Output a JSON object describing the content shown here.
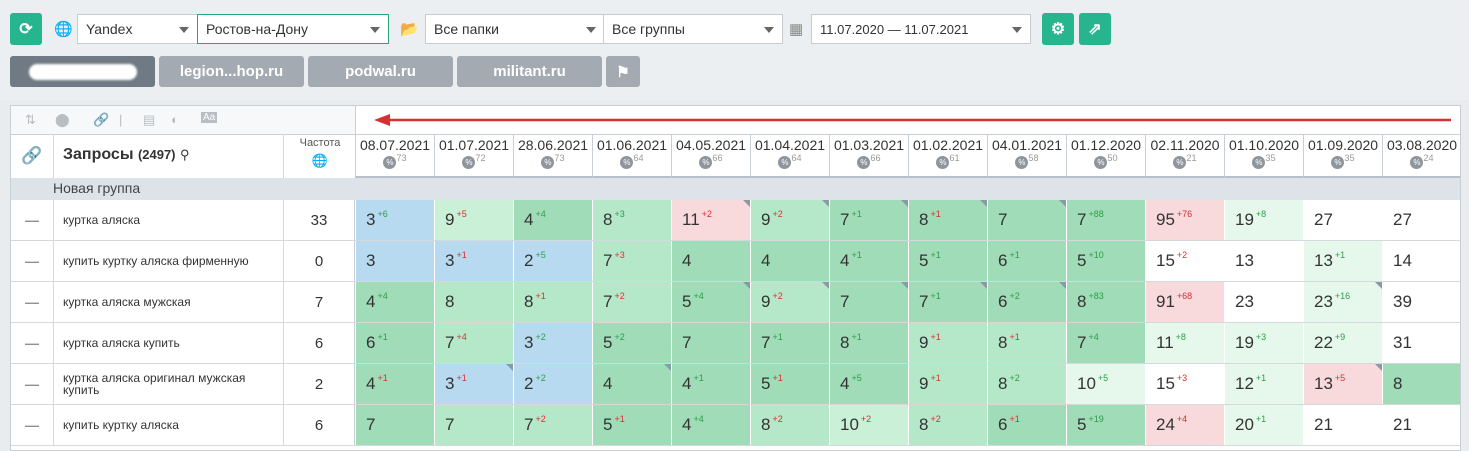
{
  "toolbar": {
    "engine": "Yandex",
    "region": "Ростов-на-Дону",
    "folders": "Все папки",
    "groups": "Все группы",
    "date_range": "11.07.2020 — 11.07.2021"
  },
  "tabs": [
    "legion...hop.ru",
    "podwal.ru",
    "militant.ru"
  ],
  "table": {
    "title": "Запросы",
    "count": "(2497)",
    "freq_label": "Частота",
    "group": "Новая группа",
    "dates": [
      {
        "d": "08.07.2021",
        "p": "73"
      },
      {
        "d": "01.07.2021",
        "p": "72"
      },
      {
        "d": "28.06.2021",
        "p": "73"
      },
      {
        "d": "01.06.2021",
        "p": "64"
      },
      {
        "d": "04.05.2021",
        "p": "66"
      },
      {
        "d": "01.04.2021",
        "p": "64"
      },
      {
        "d": "01.03.2021",
        "p": "66"
      },
      {
        "d": "01.02.2021",
        "p": "61"
      },
      {
        "d": "04.01.2021",
        "p": "58"
      },
      {
        "d": "01.12.2020",
        "p": "50"
      },
      {
        "d": "02.11.2020",
        "p": "21"
      },
      {
        "d": "01.10.2020",
        "p": "35"
      },
      {
        "d": "01.09.2020",
        "p": "35"
      },
      {
        "d": "03.08.2020",
        "p": "24"
      }
    ],
    "rows": [
      {
        "q": "куртка аляска",
        "f": "33",
        "cells": [
          [
            "3",
            "+6",
            "blue",
            0
          ],
          [
            "9",
            "+5",
            "g3",
            0
          ],
          [
            "4",
            "+4",
            "g1",
            0
          ],
          [
            "8",
            "+3",
            "g2",
            0
          ],
          [
            "11",
            "+2",
            "pink",
            1
          ],
          [
            "9",
            "+2",
            "g2",
            1
          ],
          [
            "7",
            "+1",
            "g1",
            1
          ],
          [
            "8",
            "+1",
            "g1",
            1
          ],
          [
            "7",
            "",
            "g1",
            1
          ],
          [
            "7",
            "+88",
            "g1",
            0
          ],
          [
            "95",
            "+76",
            "pink",
            0
          ],
          [
            "19",
            "+8",
            "g4",
            0
          ],
          [
            "27",
            "",
            "white",
            0
          ],
          [
            "27",
            "",
            "white",
            0
          ]
        ]
      },
      {
        "q": "купить куртку аляска фирменную",
        "f": "0",
        "cells": [
          [
            "3",
            "",
            "blue",
            0
          ],
          [
            "3",
            "+1",
            "blue",
            0
          ],
          [
            "2",
            "+5",
            "blue",
            0
          ],
          [
            "7",
            "+3",
            "g2",
            0
          ],
          [
            "4",
            "",
            "g1",
            0
          ],
          [
            "4",
            "",
            "g1",
            0
          ],
          [
            "4",
            "+1",
            "g1",
            0
          ],
          [
            "5",
            "+1",
            "g1",
            0
          ],
          [
            "6",
            "+1",
            "g1",
            0
          ],
          [
            "5",
            "+10",
            "g1",
            0
          ],
          [
            "15",
            "+2",
            "white",
            0
          ],
          [
            "13",
            "",
            "white",
            0
          ],
          [
            "13",
            "+1",
            "g4",
            0
          ],
          [
            "14",
            "",
            "white",
            0
          ]
        ]
      },
      {
        "q": "куртка аляска мужская",
        "f": "7",
        "cells": [
          [
            "4",
            "+4",
            "g1",
            0
          ],
          [
            "8",
            "",
            "g2",
            0
          ],
          [
            "8",
            "+1",
            "g2",
            0
          ],
          [
            "7",
            "+2",
            "g2",
            0
          ],
          [
            "5",
            "+4",
            "g1",
            1
          ],
          [
            "9",
            "+2",
            "g2",
            1
          ],
          [
            "7",
            "",
            "g1",
            1
          ],
          [
            "7",
            "+1",
            "g1",
            1
          ],
          [
            "6",
            "+2",
            "g1",
            1
          ],
          [
            "8",
            "+83",
            "g1",
            0
          ],
          [
            "91",
            "+68",
            "pink",
            0
          ],
          [
            "23",
            "",
            "white",
            0
          ],
          [
            "23",
            "+16",
            "g4",
            1
          ],
          [
            "39",
            "",
            "white",
            0
          ]
        ]
      },
      {
        "q": "куртка аляска купить",
        "f": "6",
        "cells": [
          [
            "6",
            "+1",
            "g1",
            0
          ],
          [
            "7",
            "+4",
            "g2",
            0
          ],
          [
            "3",
            "+2",
            "blue",
            0
          ],
          [
            "5",
            "+2",
            "g1",
            0
          ],
          [
            "7",
            "",
            "g1",
            0
          ],
          [
            "7",
            "+1",
            "g1",
            0
          ],
          [
            "8",
            "+1",
            "g1",
            0
          ],
          [
            "9",
            "+1",
            "g2",
            0
          ],
          [
            "8",
            "+1",
            "g2",
            0
          ],
          [
            "7",
            "+4",
            "g1",
            0
          ],
          [
            "11",
            "+8",
            "g4",
            0
          ],
          [
            "19",
            "+3",
            "g4",
            0
          ],
          [
            "22",
            "+9",
            "g4",
            0
          ],
          [
            "31",
            "",
            "white",
            0
          ]
        ]
      },
      {
        "q": "куртка аляска оригинал мужская купить",
        "f": "2",
        "cells": [
          [
            "4",
            "+1",
            "g1",
            0
          ],
          [
            "3",
            "+1",
            "blue",
            1
          ],
          [
            "2",
            "+2",
            "blue",
            0
          ],
          [
            "4",
            "",
            "g1",
            1
          ],
          [
            "4",
            "+1",
            "g1",
            0
          ],
          [
            "5",
            "+1",
            "g1",
            0
          ],
          [
            "4",
            "+5",
            "g1",
            0
          ],
          [
            "9",
            "+1",
            "g2",
            0
          ],
          [
            "8",
            "+2",
            "g2",
            0
          ],
          [
            "10",
            "+5",
            "g4",
            0
          ],
          [
            "15",
            "+3",
            "white",
            0
          ],
          [
            "12",
            "+1",
            "g4",
            0
          ],
          [
            "13",
            "+5",
            "pink",
            1
          ],
          [
            "8",
            "",
            "g1",
            0
          ]
        ]
      },
      {
        "q": "купить куртку аляска",
        "f": "6",
        "cells": [
          [
            "7",
            "",
            "g1",
            0
          ],
          [
            "7",
            "",
            "g2",
            0
          ],
          [
            "7",
            "+2",
            "g2",
            0
          ],
          [
            "5",
            "+1",
            "g1",
            0
          ],
          [
            "4",
            "+4",
            "g1",
            0
          ],
          [
            "8",
            "+2",
            "g2",
            0
          ],
          [
            "10",
            "+2",
            "g3",
            0
          ],
          [
            "8",
            "+2",
            "g2",
            0
          ],
          [
            "6",
            "+1",
            "g1",
            0
          ],
          [
            "5",
            "+19",
            "g1",
            0
          ],
          [
            "24",
            "+4",
            "pink",
            0
          ],
          [
            "20",
            "+1",
            "g4",
            0
          ],
          [
            "21",
            "",
            "white",
            0
          ],
          [
            "21",
            "",
            "white",
            0
          ]
        ]
      }
    ]
  }
}
